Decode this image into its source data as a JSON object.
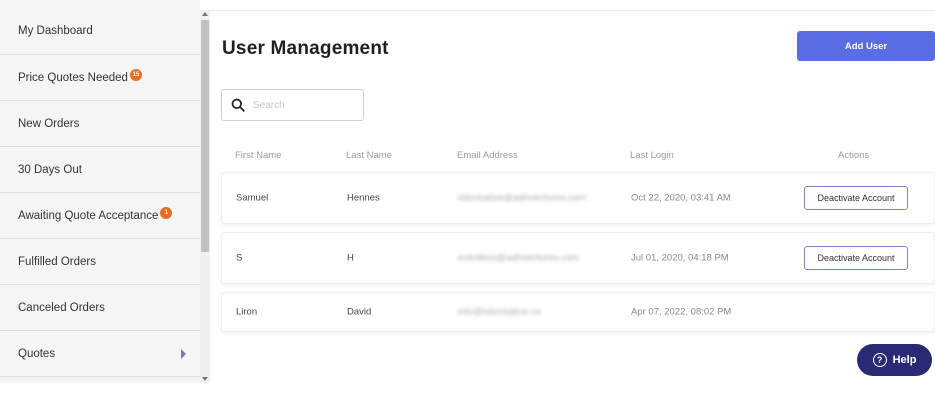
{
  "sidebar": {
    "items": [
      {
        "label": "My Dashboard"
      },
      {
        "label": "Price Quotes Needed",
        "badge": "15"
      },
      {
        "label": "New Orders"
      },
      {
        "label": "30 Days Out"
      },
      {
        "label": "Awaiting Quote Acceptance",
        "badge": "1"
      },
      {
        "label": "Fulfilled Orders"
      },
      {
        "label": "Canceled Orders"
      },
      {
        "label": "Quotes"
      }
    ]
  },
  "header": {
    "title": "User Management",
    "add_button": "Add User"
  },
  "search": {
    "placeholder": "Search"
  },
  "table": {
    "columns": [
      "First Name",
      "Last Name",
      "Email Address",
      "Last Login",
      "Actions"
    ],
    "rows": [
      {
        "first": "Samuel",
        "last": "Hennes",
        "email": "lsbcreative@adhventures.com",
        "login": "Oct 22, 2020, 03:41 AM",
        "action": "Deactivate Account"
      },
      {
        "first": "S",
        "last": "H",
        "email": "eventbos@adhventures.com",
        "login": "Jul 01, 2020, 04:18 PM",
        "action": "Deactivate Account"
      },
      {
        "first": "Liron",
        "last": "David",
        "email": "info@lsbcreative.co",
        "login": "Apr 07, 2022, 08:02 PM",
        "action": ""
      }
    ]
  },
  "help": {
    "label": "Help"
  },
  "colors": {
    "accent": "#5a6ce4",
    "badge": "#f26a1b",
    "help": "#282a73"
  }
}
